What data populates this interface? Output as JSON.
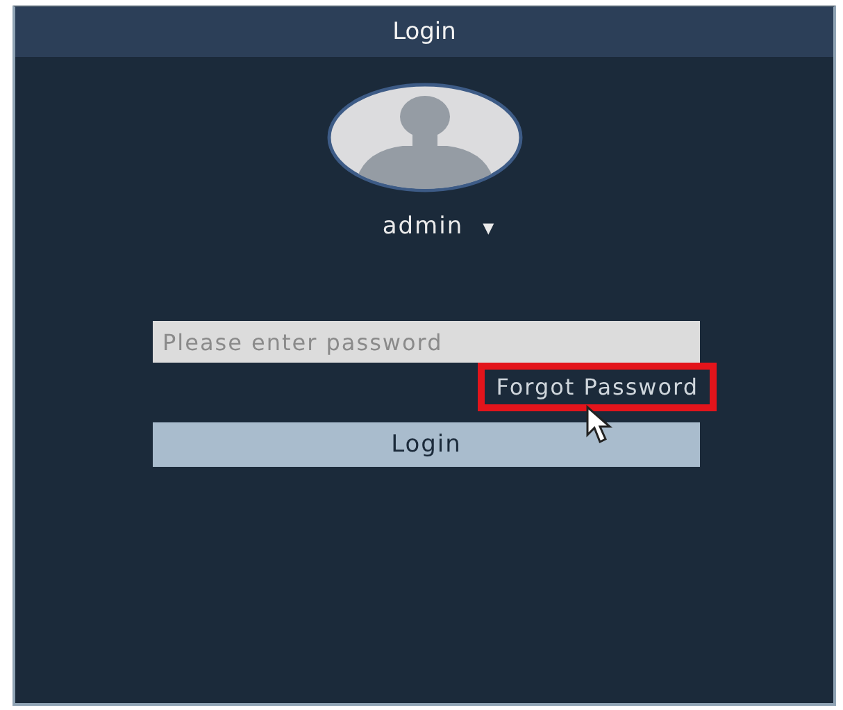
{
  "dialog": {
    "title": "Login"
  },
  "user": {
    "name": "admin",
    "caret": "▾"
  },
  "password": {
    "placeholder": "Please enter password"
  },
  "forgot_link": {
    "label": "Forgot Password",
    "highlighted": true
  },
  "login_button": {
    "label": "Login"
  }
}
